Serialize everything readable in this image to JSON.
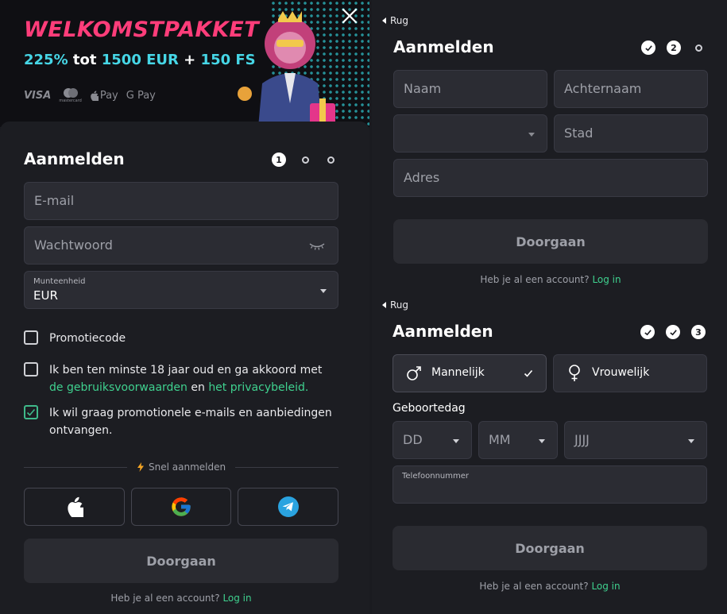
{
  "banner": {
    "title": "WELKOMSTPAKKET",
    "sub_pct": "225%",
    "sub_tot": "tot",
    "sub_amount": "1500 EUR",
    "sub_plus": "+",
    "sub_fs": "150 FS",
    "pay_visa": "VISA",
    "pay_mc": "mastercard",
    "pay_apple": "Pay",
    "pay_google": "G Pay"
  },
  "left": {
    "title": "Aanmelden",
    "step1": "1",
    "email_placeholder": "E-mail",
    "password_placeholder": "Wachtwoord",
    "currency_label": "Munteenheid",
    "currency_value": "EUR",
    "promo_label": "Promotiecode",
    "terms_text_1": "Ik ben ten minste 18 jaar oud en ga akkoord met ",
    "terms_link_1": "de gebruiksvoorwaarden",
    "terms_text_2": " en ",
    "terms_link_2": "het privacybeleid.",
    "marketing_text": "Ik wil graag promotionele e-mails en aanbiedingen ontvangen.",
    "quick_signup": "Snel aanmelden",
    "continue": "Doorgaan",
    "have_account": "Heb je al een account?",
    "login": "Log in"
  },
  "step2": {
    "back": "Rug",
    "title": "Aanmelden",
    "step_num": "2",
    "first_name": "Naam",
    "last_name": "Achternaam",
    "city": "Stad",
    "address": "Adres",
    "continue": "Doorgaan",
    "have_account": "Heb je al een account?",
    "login": "Log in"
  },
  "step3": {
    "back": "Rug",
    "title": "Aanmelden",
    "step_num": "3",
    "male": "Mannelijk",
    "female": "Vrouwelijk",
    "birthday": "Geboortedag",
    "dd": "DD",
    "mm": "MM",
    "yyyy": "JJJJ",
    "phone_label": "Telefoonnummer",
    "continue": "Doorgaan",
    "have_account": "Heb je al een account?",
    "login": "Log in"
  },
  "colors": {
    "accent_green": "#3fd18f",
    "banner_pink": "#ff3d7a",
    "banner_cyan": "#46d6e6"
  }
}
